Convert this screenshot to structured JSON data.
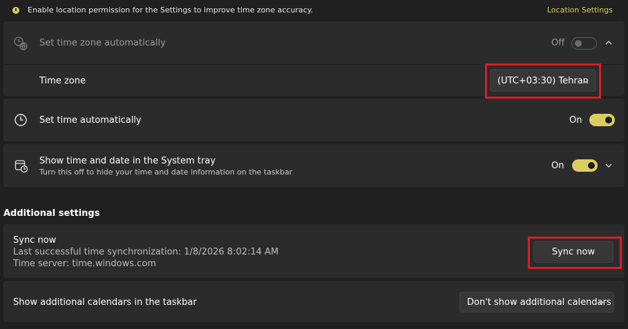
{
  "banner": {
    "message": "Enable location permission for the Settings to improve time zone accuracy.",
    "link": "Location Settings"
  },
  "set_time_zone_auto": {
    "label": "Set time zone automatically",
    "state": "Off"
  },
  "time_zone": {
    "label": "Time zone",
    "value": "(UTC+03:30) Tehran"
  },
  "set_time_auto": {
    "label": "Set time automatically",
    "state": "On"
  },
  "system_tray": {
    "label": "Show time and date in the System tray",
    "description": "Turn this off to hide your time and date information on the taskbar",
    "state": "On"
  },
  "additional_settings": {
    "heading": "Additional settings"
  },
  "sync": {
    "title": "Sync now",
    "last_sync": "Last successful time synchronization: 1/8/2026 8:02:14 AM",
    "server": "Time server: time.windows.com",
    "button": "Sync now"
  },
  "calendars": {
    "label": "Show additional calendars in the taskbar",
    "value": "Don't show additional calendars"
  },
  "colors": {
    "accent": "#dccd61",
    "highlight": "#d71f2a",
    "background": "#202020",
    "card": "#2b2b2b"
  }
}
